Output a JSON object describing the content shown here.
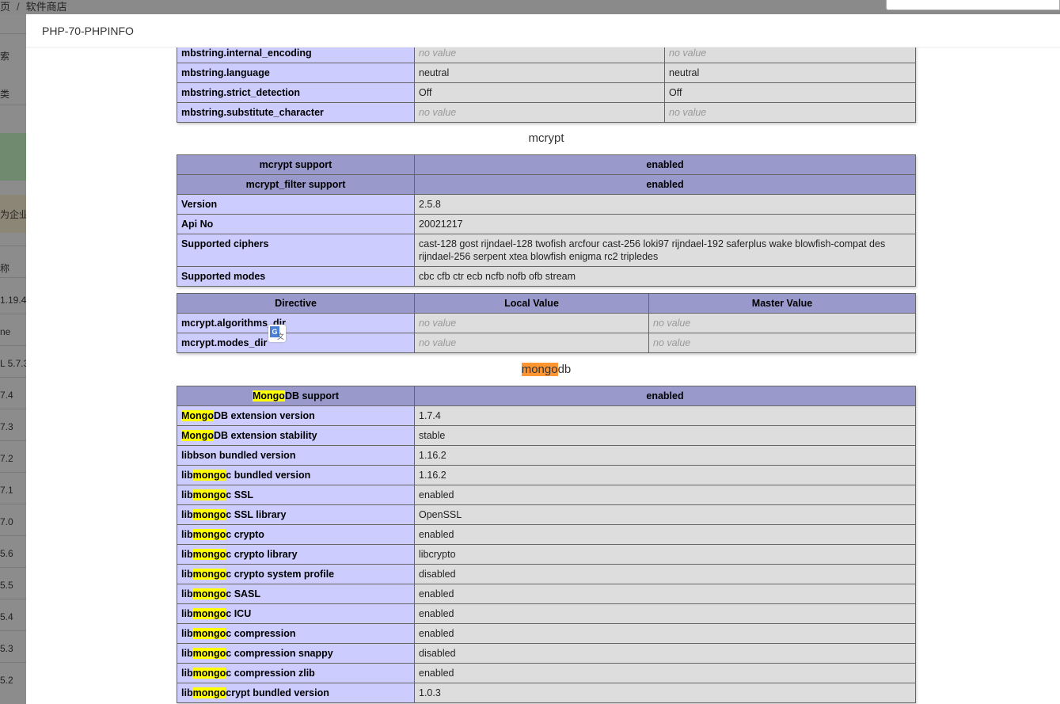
{
  "background": {
    "breadcrumb": {
      "home": "页",
      "sep": "/",
      "current": "软件商店"
    },
    "side_items": [
      "索",
      "类",
      "为企业",
      "称",
      "1.19.4",
      "ne",
      "L 5.7.3",
      "7.4",
      "7.3",
      "7.2",
      "7.1",
      "7.0",
      "5.6",
      "5.5",
      "5.4",
      "5.3",
      "5.2"
    ]
  },
  "modal": {
    "title": "PHP-70-PHPINFO"
  },
  "mbstring_rows": [
    {
      "name": "mbstring.internal_encoding",
      "local": "no value",
      "master": "no value"
    },
    {
      "name": "mbstring.language",
      "local": "neutral",
      "master": "neutral"
    },
    {
      "name": "mbstring.strict_detection",
      "local": "Off",
      "master": "Off"
    },
    {
      "name": "mbstring.substitute_character",
      "local": "no value",
      "master": "no value"
    }
  ],
  "mcrypt": {
    "title": "mcrypt",
    "info": [
      {
        "name": "mcrypt support",
        "value": "enabled",
        "header": true
      },
      {
        "name": "mcrypt_filter support",
        "value": "enabled",
        "header": true
      },
      {
        "name": "Version",
        "value": "2.5.8"
      },
      {
        "name": "Api No",
        "value": "20021217"
      },
      {
        "name": "Supported ciphers",
        "value": "cast-128 gost rijndael-128 twofish arcfour cast-256 loki97 rijndael-192 saferplus wake blowfish-compat des rijndael-256 serpent xtea blowfish enigma rc2 tripledes"
      },
      {
        "name": "Supported modes",
        "value": "cbc cfb ctr ecb ncfb nofb ofb stream"
      }
    ],
    "directive_header": {
      "directive": "Directive",
      "local": "Local Value",
      "master": "Master Value"
    },
    "directives": [
      {
        "name": "mcrypt.algorithms_dir",
        "local": "no value",
        "master": "no value"
      },
      {
        "name": "mcrypt.modes_dir",
        "local": "no value",
        "master": "no value"
      }
    ]
  },
  "mongodb": {
    "title_hl": "mongo",
    "title_rest": "db",
    "header": {
      "pre": "",
      "hl": "Mongo",
      "post": "DB support",
      "value": "enabled"
    },
    "rows": [
      {
        "pre": "",
        "hl": "Mongo",
        "post": "DB extension version",
        "value": "1.7.4"
      },
      {
        "pre": "",
        "hl": "Mongo",
        "post": "DB extension stability",
        "value": "stable"
      },
      {
        "pre": "libbson bundled version",
        "hl": "",
        "post": "",
        "value": "1.16.2"
      },
      {
        "pre": "lib",
        "hl": "mongo",
        "post": "c bundled version",
        "value": "1.16.2"
      },
      {
        "pre": "lib",
        "hl": "mongo",
        "post": "c SSL",
        "value": "enabled"
      },
      {
        "pre": "lib",
        "hl": "mongo",
        "post": "c SSL library",
        "value": "OpenSSL"
      },
      {
        "pre": "lib",
        "hl": "mongo",
        "post": "c crypto",
        "value": "enabled"
      },
      {
        "pre": "lib",
        "hl": "mongo",
        "post": "c crypto library",
        "value": "libcrypto"
      },
      {
        "pre": "lib",
        "hl": "mongo",
        "post": "c crypto system profile",
        "value": "disabled"
      },
      {
        "pre": "lib",
        "hl": "mongo",
        "post": "c SASL",
        "value": "enabled"
      },
      {
        "pre": "lib",
        "hl": "mongo",
        "post": "c ICU",
        "value": "enabled"
      },
      {
        "pre": "lib",
        "hl": "mongo",
        "post": "c compression",
        "value": "enabled"
      },
      {
        "pre": "lib",
        "hl": "mongo",
        "post": "c compression snappy",
        "value": "disabled"
      },
      {
        "pre": "lib",
        "hl": "mongo",
        "post": "c compression zlib",
        "value": "enabled"
      },
      {
        "pre": "lib",
        "hl": "mongo",
        "post": "crypt bundled version",
        "value": "1.0.3"
      }
    ]
  },
  "colors": {
    "header_bg": "#9999cc",
    "key_bg": "#ccccff",
    "value_bg": "#dddddd",
    "search_highlight": "#ffff00",
    "current_highlight": "#ff9632"
  }
}
